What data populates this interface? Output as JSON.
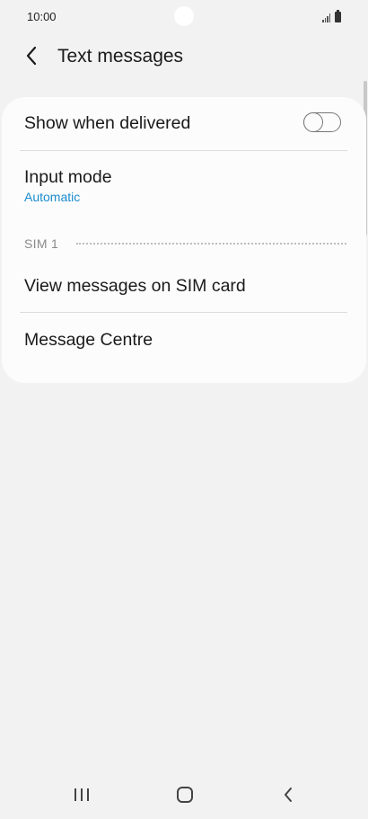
{
  "status_bar": {
    "time": "10:00"
  },
  "header": {
    "title": "Text messages",
    "back_icon": "chevron-left-icon"
  },
  "settings": {
    "show_when_delivered": {
      "label": "Show when delivered",
      "enabled": false
    },
    "input_mode": {
      "label": "Input mode",
      "value": "Automatic"
    },
    "section_label": "SIM 1",
    "view_messages": {
      "label": "View messages on SIM card"
    },
    "message_centre": {
      "label": "Message Centre"
    }
  },
  "nav_bar": {
    "recents_icon": "recent-apps-icon",
    "home_icon": "home-icon",
    "back_icon": "back-icon"
  },
  "colors": {
    "background": "#f2f2f2",
    "card": "#fcfcfc",
    "accent": "#1a8ccf",
    "section_label": "#8a8a8a"
  }
}
